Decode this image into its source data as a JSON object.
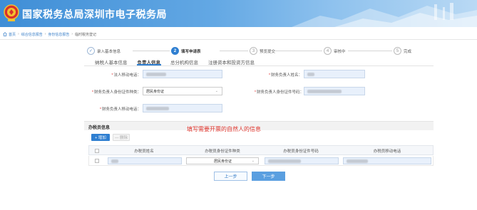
{
  "header": {
    "title": "国家税务总局深圳市电子税务局"
  },
  "breadcrumb": {
    "items": [
      "首页",
      "综合信息报告",
      "身份信息报告",
      "临时税务登记"
    ]
  },
  "stepper": {
    "steps": [
      {
        "num": "✓",
        "label": "录入基本信息",
        "state": "done"
      },
      {
        "num": "2",
        "label": "填写申请表",
        "state": "active"
      },
      {
        "num": "3",
        "label": "预览提交",
        "state": "todo"
      },
      {
        "num": "4",
        "label": "审核中",
        "state": "todo"
      },
      {
        "num": "5",
        "label": "完成",
        "state": "todo"
      }
    ]
  },
  "tabs": [
    {
      "label": "纳税人基本信息",
      "active": false
    },
    {
      "label": "负责人信息",
      "active": true
    },
    {
      "label": "总分机构信息",
      "active": false
    },
    {
      "label": "注册资本和投资方信息",
      "active": false
    }
  ],
  "form": {
    "legal_phone_label": "法人移动电话：",
    "finance_name_label": "财务负责人姓名：",
    "finance_id_type_label": "财务负责人身份证件种类：",
    "finance_id_type_value": "居民身份证",
    "finance_id_no_label": "财务负责人身份证件号码：",
    "finance_phone_label": "财务负责人移动电话："
  },
  "section": {
    "title": "办税员信息",
    "annotation": "填写需要开票的自然人的信息"
  },
  "actions": {
    "add": "+ 增加",
    "delete": "— 删除"
  },
  "table": {
    "columns": [
      "办税员姓名",
      "办税员身份证件种类",
      "办税员身份证件号码",
      "办税员移动电话"
    ],
    "row": {
      "id_type": "居民身份证"
    }
  },
  "nav": {
    "prev": "上一步",
    "next": "下一步"
  },
  "colors": {
    "accent": "#2f7fd1",
    "required": "#e03030",
    "annotation": "#e0362e"
  }
}
